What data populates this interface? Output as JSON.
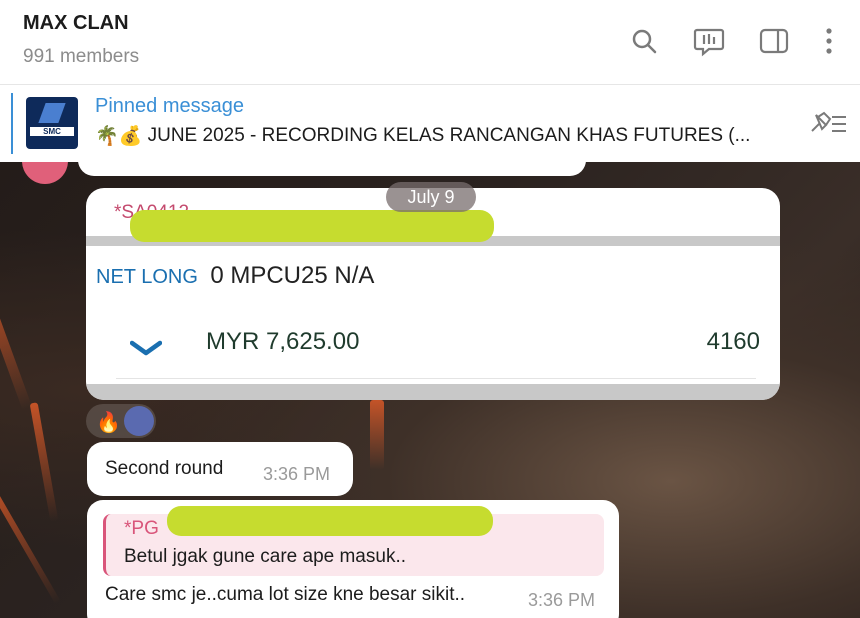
{
  "header": {
    "title": "MAX CLAN",
    "members": "991 members"
  },
  "pinned": {
    "label": "Pinned message",
    "thumb_text": "SMC",
    "text": "JUNE 2025 - RECORDING KELAS RANCANGAN KHAS FUTURES (...",
    "emoji": "🌴💰"
  },
  "chat": {
    "date": "July 9",
    "card": {
      "header": "*SA0412",
      "net_long": "NET LONG",
      "contract": "0 MPCU25 N/A",
      "amount": "MYR 7,625.00",
      "qty": "4160"
    },
    "reactions": {
      "fire": "🔥"
    },
    "messages": [
      {
        "text": "Second round",
        "time": "3:36 PM"
      },
      {
        "quote_name": "*PG",
        "quote_text": "Betul jgak gune care ape masuk..",
        "text": "Care smc je..cuma lot size kne besar sikit..",
        "time": "3:36 PM"
      }
    ]
  },
  "colors": {
    "accent": "#3a8fd6",
    "quote_accent": "#d9557a",
    "redaction": "#c6dc2f"
  }
}
